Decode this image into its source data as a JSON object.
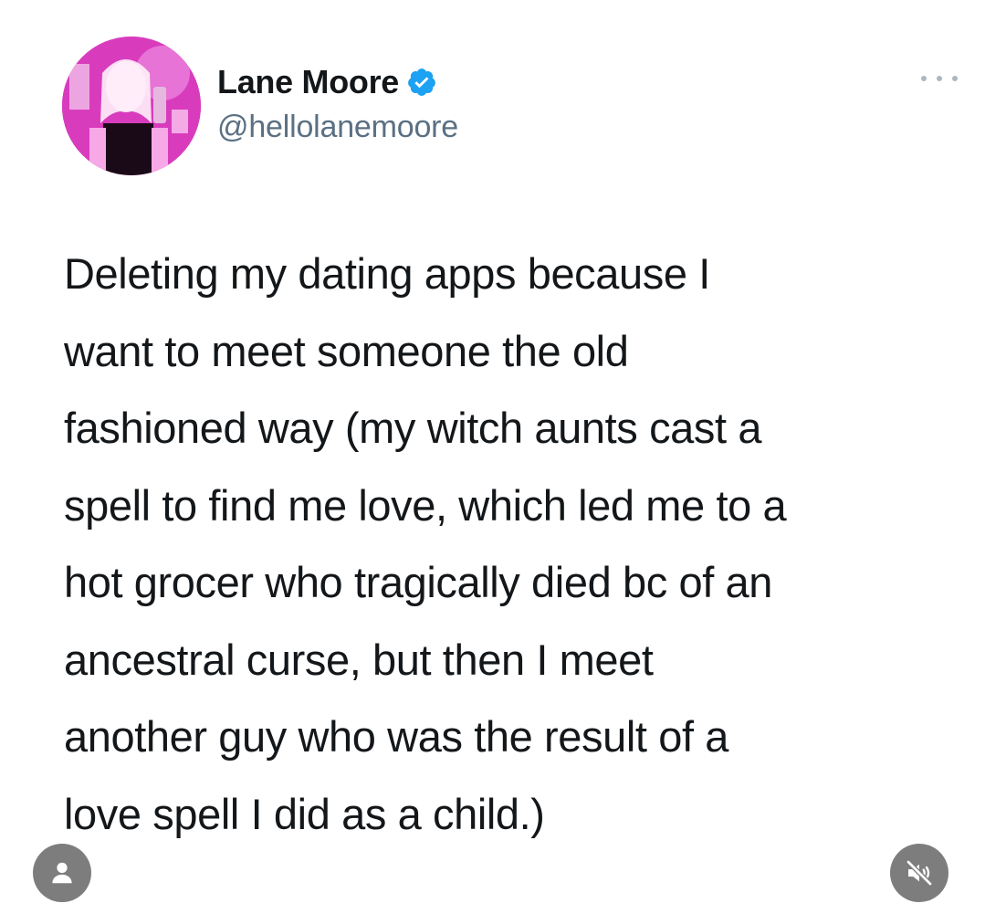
{
  "author": {
    "display_name": "Lane Moore",
    "handle": "@hellolanemoore",
    "verified": true,
    "avatar_icon": "profile-photo"
  },
  "tweet": {
    "lines": [
      "Deleting my dating apps because I",
      "want to meet someone the old",
      "fashioned way (my witch aunts cast a",
      "spell to find me love, which led me to a",
      "hot grocer who tragically died bc of an",
      "ancestral curse, but then I meet",
      "another guy who was the result of a",
      "love spell I did as a child.)"
    ]
  },
  "controls": {
    "more_icon": "more-dots-icon",
    "user_icon": "user-icon",
    "mute_icon": "muted-speaker-icon"
  },
  "colors": {
    "verified": "#1da1f2",
    "handle": "#5b7083",
    "overlay_button": "#7d7d7d"
  }
}
